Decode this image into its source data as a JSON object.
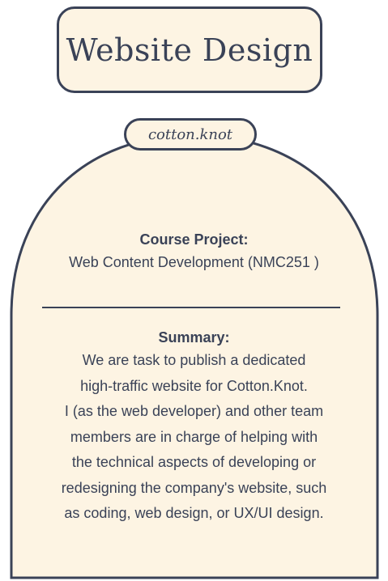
{
  "header": {
    "title": "Website Design"
  },
  "brand": {
    "label": "cotton.knot"
  },
  "project": {
    "heading": "Course Project:",
    "course": "Web Content Development (NMC251 )"
  },
  "summary": {
    "heading": "Summary:",
    "lines": [
      "We are task to publish a dedicated",
      "high-traffic website for Cotton.Knot.",
      "I (as the web developer) and other team",
      "members are in charge of helping with",
      "the technical aspects of developing or",
      "redesigning the company's website, such",
      "as coding, web design, or UX/UI design."
    ]
  },
  "colors": {
    "ink": "#3a4257",
    "paper": "#fdf4e3"
  }
}
